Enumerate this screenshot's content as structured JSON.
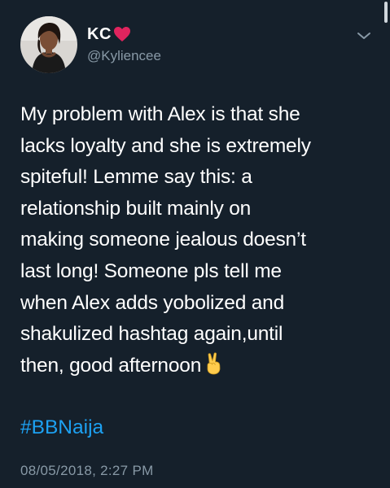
{
  "user": {
    "display_name": "KC",
    "handle": "@Kyliencee"
  },
  "tweet": {
    "text": "My problem with Alex is that she\nlacks loyalty and she is extremely\nspiteful! Lemme say this: a\nrelationship built mainly on\nmaking someone jealous doesn’t\nlast long! Someone pls tell me\nwhen Alex adds yobolized and\nshakulized hashtag again,until\nthen, good afternoon",
    "hashtag": "#BBNaija",
    "timestamp": "08/05/2018, 2:27 PM"
  },
  "icons": {
    "name_emoji": "heart-icon",
    "text_emoji": "victory-hand-icon",
    "menu": "chevron-down-icon"
  },
  "colors": {
    "background": "#15202b",
    "text": "#ffffff",
    "secondary_text": "#8899a6",
    "link": "#1da1f2",
    "heart": "#e0245e",
    "victory_hand": "#ffcc4d"
  }
}
